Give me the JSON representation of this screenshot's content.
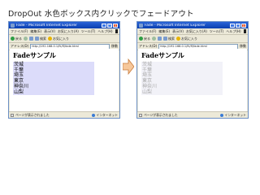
{
  "slide": {
    "title": "DropOut 水色ボックス内クリックでフェードアウト"
  },
  "windows": [
    {
      "title": "Fade - Microsoft Internet Explorer",
      "menu": [
        "ファイル(F)",
        "編集(E)",
        "表示(V)",
        "お気に入り(A)",
        "ツール(T)",
        "ヘルプ(H)"
      ],
      "toolbar": {
        "back": "戻る",
        "search": "検索",
        "favorites": "お気に入り"
      },
      "address_label": "アドレス(D)",
      "address_url": "http://192.168.0.1/fk/fl/fade.html",
      "go_label": "移動",
      "page_heading": "Fadeサンプル",
      "items": [
        "茨城",
        "千葉",
        "埼玉",
        "東京",
        "神奈川",
        "山梨"
      ],
      "status_text": "ページが表示されました",
      "status_zone": "インターネット"
    },
    {
      "title": "Fade - Microsoft Internet Explorer",
      "menu": [
        "ファイル(F)",
        "編集(E)",
        "表示(V)",
        "お気に入り(A)",
        "ツール(T)",
        "ヘルプ(H)"
      ],
      "toolbar": {
        "back": "戻る",
        "search": "検索",
        "favorites": "お気に入り"
      },
      "address_label": "アドレス(D)",
      "address_url": "http://192.168.0.1/fk/fl/fade.html",
      "go_label": "移動",
      "page_heading": "Fadeサンプル",
      "items": [
        "茨城",
        "千葉",
        "埼玉",
        "東京",
        "神奈川",
        "山梨"
      ],
      "status_text": "ページが表示されました",
      "status_zone": "インターネット"
    }
  ],
  "colors": {
    "box_visible": "#dcdcfa",
    "box_faded": "#f2f2f8",
    "arrow_fill": "#f6c79a",
    "arrow_stroke": "#c87a3a"
  }
}
